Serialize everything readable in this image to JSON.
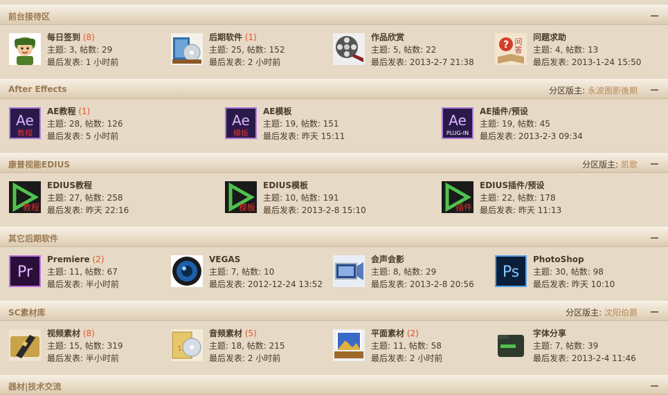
{
  "colors": {
    "accent": "#e0532a",
    "moderator": "#b88a58",
    "title": "#9a7a52",
    "background": "#e6d9c5"
  },
  "sections": [
    {
      "title": "前台接待区",
      "moderator_label": "",
      "moderator": "",
      "forums": [
        {
          "icon": "soldier-icon",
          "name": "每日签到",
          "new": "(8)",
          "stats": "主题: 3, 帖数: 29",
          "last": "最后发表: 1 小时前"
        },
        {
          "icon": "software-box-icon",
          "name": "后期软件",
          "new": "(1)",
          "stats": "主题: 25, 帖数: 152",
          "last": "最后发表: 2 小时前"
        },
        {
          "icon": "film-reel-icon",
          "name": "作品欣赏",
          "new": "",
          "stats": "主题: 5, 帖数: 22",
          "last": "最后发表: 2013-2-7 21:38"
        },
        {
          "icon": "qa-book-icon",
          "name": "问题求助",
          "new": "",
          "stats": "主题: 4, 帖数: 13",
          "last": "最后发表: 2013-1-24 15:50"
        }
      ]
    },
    {
      "title": "After Effects",
      "moderator_label": "分区版主: ",
      "moderator": "永波图影後期",
      "forums": [
        {
          "icon": "ae-tutorial-icon",
          "name": "AE教程",
          "new": "(1)",
          "stats": "主题: 28, 帖数: 126",
          "last": "最后发表: 5 小时前",
          "badge": "Ae",
          "sub": "教程"
        },
        {
          "icon": "ae-template-icon",
          "name": "AE模板",
          "new": "",
          "stats": "主题: 19, 帖数: 151",
          "last": "最后发表: 昨天 15:11",
          "badge": "Ae",
          "sub": "模板"
        },
        {
          "icon": "ae-plugin-icon",
          "name": "AE插件/预设",
          "new": "",
          "stats": "主题: 19, 帖数: 45",
          "last": "最后发表: 2013-2-3 09:34",
          "badge": "Ae",
          "sub": "PLUG-IN"
        }
      ]
    },
    {
      "title": "康普视能EDIUS",
      "moderator_label": "分区版主: ",
      "moderator": "凯歌",
      "forums": [
        {
          "icon": "edius-tutorial-icon",
          "name": "EDIUS教程",
          "new": "",
          "stats": "主题: 27, 帖数: 258",
          "last": "最后发表: 昨天 22:16",
          "sub": "教程"
        },
        {
          "icon": "edius-template-icon",
          "name": "EDIUS模板",
          "new": "",
          "stats": "主题: 10, 帖数: 191",
          "last": "最后发表: 2013-2-8 15:10",
          "sub": "模板"
        },
        {
          "icon": "edius-plugin-icon",
          "name": "EDIUS插件/预设",
          "new": "",
          "stats": "主题: 22, 帖数: 178",
          "last": "最后发表: 昨天 11:13",
          "sub": "插件"
        }
      ]
    },
    {
      "title": "其它后期软件",
      "moderator_label": "",
      "moderator": "",
      "forums": [
        {
          "icon": "premiere-icon",
          "name": "Premiere",
          "new": "(2)",
          "stats": "主题: 11, 帖数: 67",
          "last": "最后发表: 半小时前",
          "badge": "Pr"
        },
        {
          "icon": "vegas-lens-icon",
          "name": "VEGAS",
          "new": "",
          "stats": "主题: 7, 帖数: 10",
          "last": "最后发表: 2012-12-24 13:52"
        },
        {
          "icon": "video-studio-icon",
          "name": "会声会影",
          "new": "",
          "stats": "主题: 8, 帖数: 29",
          "last": "最后发表: 2013-2-8 20:56"
        },
        {
          "icon": "photoshop-icon",
          "name": "PhotoShop",
          "new": "",
          "stats": "主题: 30, 帖数: 98",
          "last": "最后发表: 昨天 10:10",
          "badge": "Ps"
        }
      ]
    },
    {
      "title": "SC素材库",
      "moderator_label": "分区版主: ",
      "moderator": "沈阳伯爵",
      "forums": [
        {
          "icon": "film-folder-icon",
          "name": "视频素材",
          "new": "(8)",
          "stats": "主题: 15, 帖数: 319",
          "last": "最后发表: 半小时前"
        },
        {
          "icon": "music-cd-icon",
          "name": "音频素材",
          "new": "(5)",
          "stats": "主题: 18, 帖数: 215",
          "last": "最后发表: 2 小时前"
        },
        {
          "icon": "image-tray-icon",
          "name": "平面素材",
          "new": "(2)",
          "stats": "主题: 11, 帖数: 58",
          "last": "最后发表: 2 小时前"
        },
        {
          "icon": "font-folder-icon",
          "name": "字体分享",
          "new": "",
          "stats": "主题: 7, 帖数: 39",
          "last": "最后发表: 2013-2-4 11:46"
        }
      ]
    },
    {
      "title": "器材|技术交流",
      "moderator_label": "",
      "moderator": "",
      "forums": []
    }
  ]
}
